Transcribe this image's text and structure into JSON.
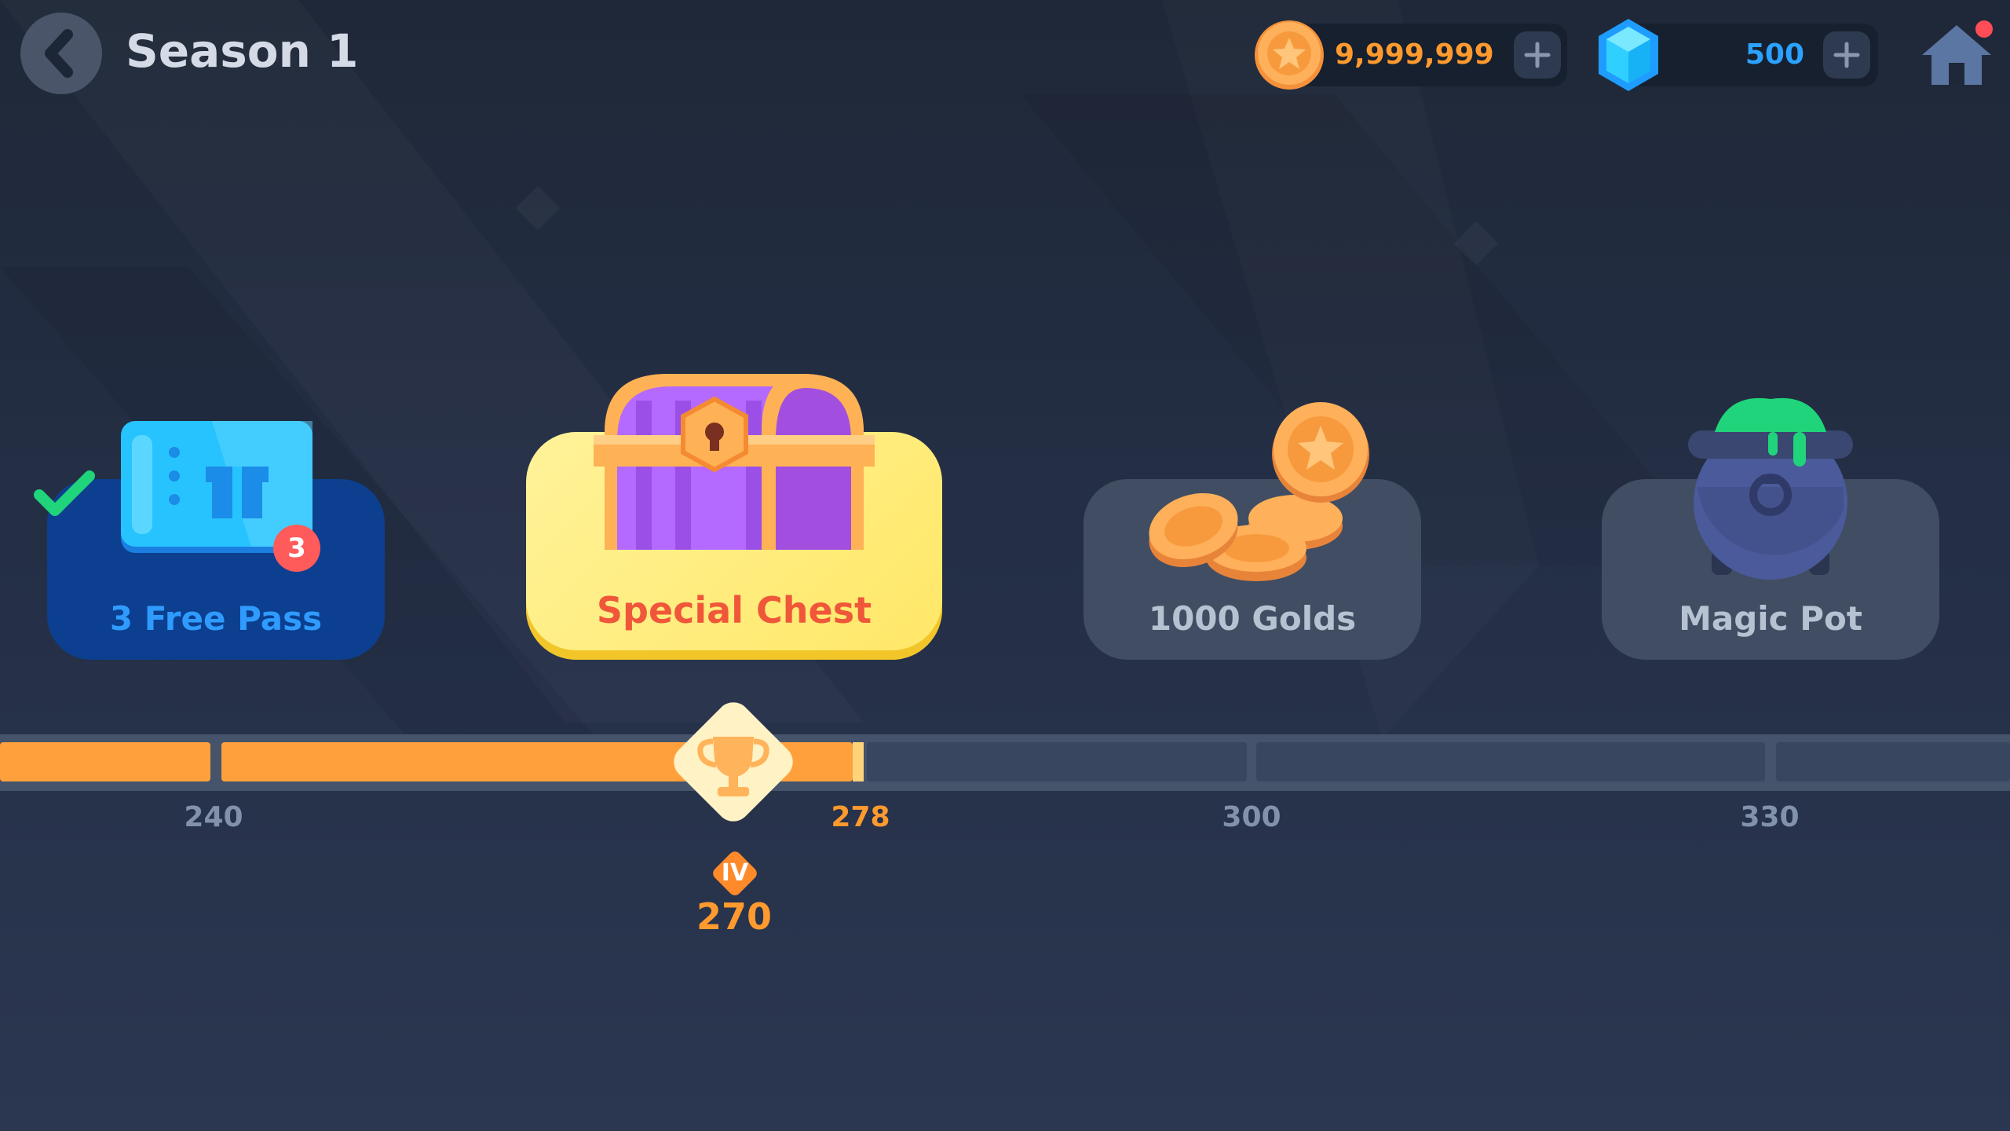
{
  "header": {
    "title": "Season 1",
    "back_icon": "chevron-left-icon",
    "home_icon": "home-icon",
    "home_notification": true
  },
  "currencies": {
    "gold": {
      "value": "9,999,999",
      "icon": "gold-coin-icon",
      "color": "#ff9a2e"
    },
    "gems": {
      "value": "500",
      "icon": "blue-gem-icon",
      "color": "#2ba2ff"
    }
  },
  "rewards": [
    {
      "label": "3 Free Pass",
      "badge": "3",
      "claimed": true,
      "icon": "ticket-icon"
    },
    {
      "label": "Special Chest",
      "highlighted": true,
      "icon": "treasure-chest-icon"
    },
    {
      "label": "1000 Golds",
      "icon": "coin-pile-icon"
    },
    {
      "label": "Magic Pot",
      "icon": "cauldron-icon"
    }
  ],
  "progress": {
    "ticks": [
      "240",
      "278",
      "300",
      "330"
    ],
    "current_tick": "278",
    "current_value": "270",
    "rank": "IV",
    "marker_icon": "trophy-icon"
  },
  "colors": {
    "progress_fill": "#ffa03c",
    "progress_empty": "#384660",
    "highlight_card": "#ffe766",
    "claimed_card": "#0c3f8f"
  }
}
